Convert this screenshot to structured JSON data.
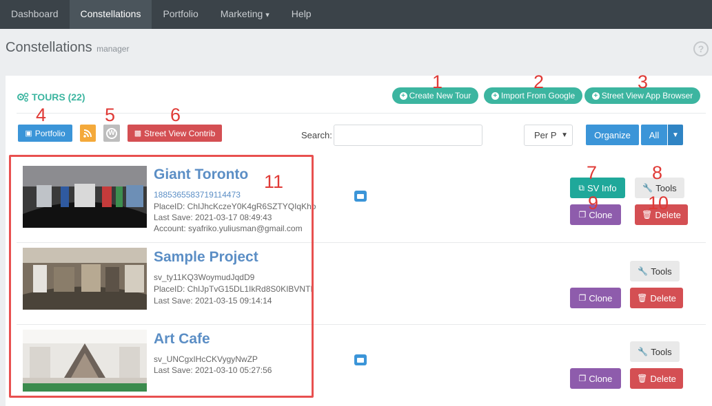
{
  "nav": {
    "items": [
      {
        "label": "Dashboard",
        "active": false
      },
      {
        "label": "Constellations",
        "active": true
      },
      {
        "label": "Portfolio",
        "active": false
      },
      {
        "label": "Marketing",
        "active": false,
        "dropdown": true
      },
      {
        "label": "Help",
        "active": false
      }
    ]
  },
  "header": {
    "title": "Constellations",
    "subtitle": "manager",
    "help_icon": "question-circle-icon"
  },
  "tours": {
    "title": "TOURS (22)"
  },
  "actions": {
    "create_new_tour": "Create New Tour",
    "import_from_google": "Import From Google",
    "street_view_app_browser": "Street View App Browser",
    "portfolio": "Portfolio",
    "street_view_contrib": "Street View Contrib",
    "search_label": "Search:",
    "search_value": "",
    "per_page": "Per P",
    "organize": "Organize",
    "all": "All"
  },
  "tour_list": [
    {
      "name": "Giant Toronto",
      "id": "1885365583719114473",
      "place_id": "PlaceID: ChIJhcKczeY0K4gR6SZTYQIqKho",
      "last_save": "Last Save: 2021-03-17 08:49:43",
      "account": "Account: syafriko.yuliusman@gmail.com",
      "buttons": {
        "sv_info": "SV Info",
        "tools": "Tools",
        "clone": "Clone",
        "delete": "Delete"
      }
    },
    {
      "name": "Sample Project",
      "id": "sv_ty11KQ3WoymudJqdD9",
      "place_id": "PlaceID: ChIJpTvG15DL1IkRd8S0KIBVNTI",
      "last_save": "Last Save: 2021-03-15 09:14:14",
      "buttons": {
        "tools": "Tools",
        "clone": "Clone",
        "delete": "Delete"
      }
    },
    {
      "name": "Art Cafe",
      "id": "sv_UNCgxIHcCKVygyNwZP",
      "last_save": "Last Save: 2021-03-10 05:27:56",
      "buttons": {
        "tools": "Tools",
        "clone": "Clone",
        "delete": "Delete"
      }
    }
  ],
  "annotations": [
    "1",
    "2",
    "3",
    "4",
    "5",
    "6",
    "7",
    "8",
    "9",
    "10",
    "11"
  ],
  "colors": {
    "nav_bg": "#3b4349",
    "teal": "#3cb5a0",
    "blue": "#3b95d8",
    "purple": "#8e5cac",
    "red": "#d44f53",
    "annotation": "#e03a36"
  }
}
